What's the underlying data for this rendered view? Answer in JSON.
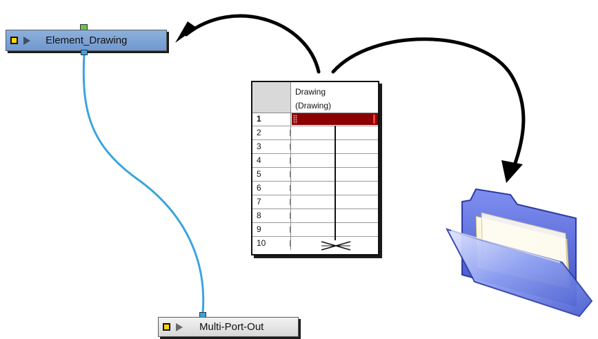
{
  "nodes": {
    "element": {
      "label": "Element_Drawing"
    },
    "multi_port_out": {
      "label": "Multi-Port-Out"
    }
  },
  "xsheet": {
    "column_title_line1": "Drawing",
    "column_title_line2": "(Drawing)",
    "rows": [
      "1",
      "2",
      "3",
      "4",
      "5",
      "6",
      "7",
      "8",
      "9",
      "10"
    ],
    "selected_row": "1"
  },
  "colors": {
    "node_blue": "#7ea6d8",
    "cable": "#3aa4dc",
    "selected_cell": "#8b0000",
    "port_green": "#6cc04a",
    "folder_blue": "#5b6fd6"
  },
  "icons": [
    "bullet-icon",
    "play-icon",
    "folder-icon",
    "arrow-icon"
  ]
}
